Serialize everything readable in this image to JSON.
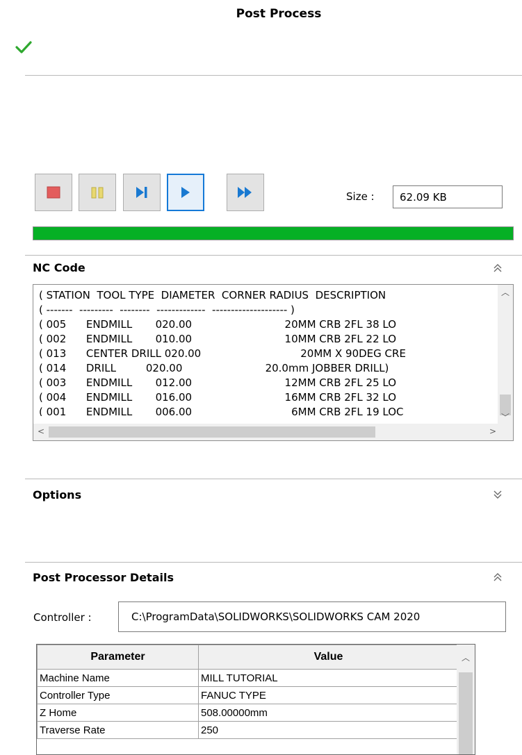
{
  "header": {
    "title": "Post Process",
    "confirm_icon": "checkmark-icon",
    "confirm_color": "#2fa82f"
  },
  "toolbar": {
    "buttons": [
      {
        "name": "stop-button",
        "icon": "stop-icon",
        "color": "#e35d5d"
      },
      {
        "name": "pause-button",
        "icon": "pause-icon",
        "color": "#e8d870"
      },
      {
        "name": "step-button",
        "icon": "step-icon",
        "color": "#1979d1"
      },
      {
        "name": "play-button",
        "icon": "play-icon",
        "color": "#1979d1"
      },
      {
        "name": "fast-forward-button",
        "icon": "fast-forward-icon",
        "color": "#1979d1"
      }
    ],
    "size_label": "Size :",
    "size_value": "62.09 KB"
  },
  "progress": {
    "percent": 100,
    "color": "#06b025"
  },
  "nc_code": {
    "title": "NC Code",
    "lines": [
      "( STATION  TOOL TYPE  DIAMETER  CORNER RADIUS  DESCRIPTION",
      "( -------  ---------  --------  -------------  -------------------- )",
      "( 005      ENDMILL       020.00                            20MM CRB 2FL 38 LO",
      "( 002      ENDMILL       010.00                            10MM CRB 2FL 22 LO",
      "( 013      CENTER DRILL 020.00                              20MM X 90DEG CRE",
      "( 014      DRILL         020.00                         20.0mm JOBBER DRILL)",
      "( 003      ENDMILL       012.00                            12MM CRB 2FL 25 LO",
      "( 004      ENDMILL       016.00                            16MM CRB 2FL 32 LO",
      "( 001      ENDMILL       006.00                              6MM CRB 2FL 19 LOC"
    ]
  },
  "options": {
    "title": "Options"
  },
  "post_processor": {
    "title": "Post Processor Details",
    "controller_label": "Controller :",
    "controller_path": "C:\\ProgramData\\SOLIDWORKS\\SOLIDWORKS CAM 2020",
    "table": {
      "headers": [
        "Parameter",
        "Value"
      ],
      "rows": [
        [
          "Machine Name",
          "MILL TUTORIAL"
        ],
        [
          "Controller Type",
          "FANUC TYPE"
        ],
        [
          "Z Home",
          "508.00000mm"
        ],
        [
          "Traverse Rate",
          "250"
        ]
      ]
    }
  }
}
